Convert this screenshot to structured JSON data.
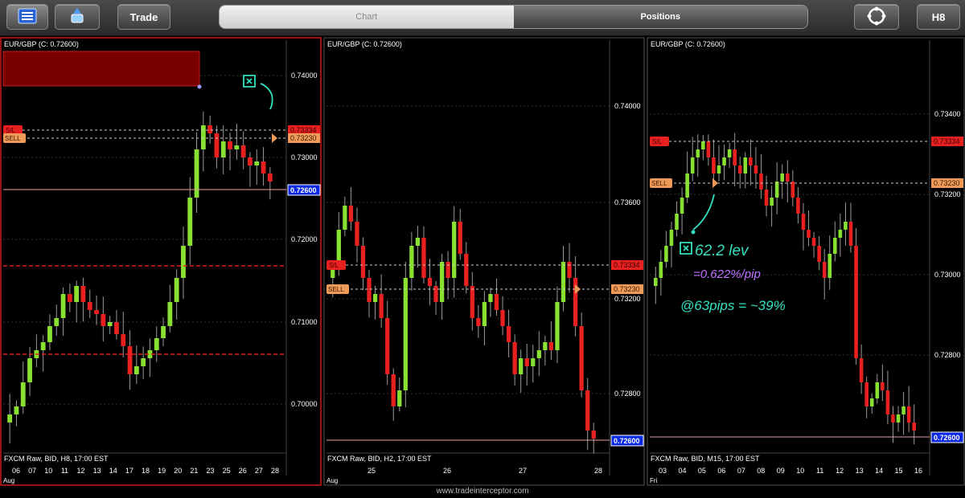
{
  "toolbar": {
    "trade_label": "Trade",
    "tab_chart": "Chart",
    "tab_positions": "Positions",
    "timeframe_label": "H8",
    "menu_icon": "list-icon",
    "drawing_icon": "drawing-tool-icon",
    "refresh_icon": "refresh-cycle-icon"
  },
  "footer": {
    "url": "www.tradeinterceptor.com"
  },
  "colors": {
    "up": "#88e030",
    "down": "#e82020",
    "sl": "#e82020",
    "sell": "#f09a5a",
    "price": "#0a28e6"
  },
  "panels": [
    {
      "title": "EUR/GBP (C: 0.72600)",
      "footer_text": "FXCM Raw, BID, H8, 17:00 EST",
      "month_label": "Aug",
      "yticks": [
        "0.74000",
        "0.73000",
        "0.72000",
        "0.71000",
        "0.70000"
      ],
      "xticks": [
        "06",
        "07",
        "10",
        "11",
        "12",
        "13",
        "14",
        "17",
        "18",
        "19",
        "20",
        "21",
        "23",
        "25",
        "26",
        "27",
        "28"
      ],
      "sl_label": "S/L",
      "sl_value": "0.73334",
      "sell_label": "SELL",
      "sell_value": "0.73230",
      "price_value": "0.72600"
    },
    {
      "title": "EUR/GBP (C: 0.72600)",
      "footer_text": "FXCM Raw, BID, H2, 17:00 EST",
      "month_label": "Aug",
      "yticks": [
        "0.74000",
        "0.73600",
        "0.73200",
        "0.72800"
      ],
      "xticks": [
        "25",
        "26",
        "27",
        "28"
      ],
      "sl_label": "S/L",
      "sl_value": "0.73334",
      "sell_label": "SELL",
      "sell_value": "0.73230",
      "price_value": "0.72600"
    },
    {
      "title": "EUR/GBP (C: 0.72600)",
      "footer_text": "FXCM Raw, BID, M15, 17:00 EST",
      "month_label": "Fri",
      "yticks": [
        "0.73400",
        "0.73200",
        "0.73000",
        "0.72800"
      ],
      "xticks": [
        "03",
        "04",
        "05",
        "06",
        "07",
        "08",
        "09",
        "10",
        "11",
        "12",
        "13",
        "14",
        "15",
        "16"
      ],
      "sl_label": "S/L",
      "sl_value": "0.73334",
      "sell_label": "SELL",
      "sell_value": "0.73230",
      "price_value": "0.72600"
    }
  ],
  "annotations": {
    "note1": "62.2 lev",
    "note2": "=0.622%/pip",
    "note3": "@63pips = ~39%"
  }
}
